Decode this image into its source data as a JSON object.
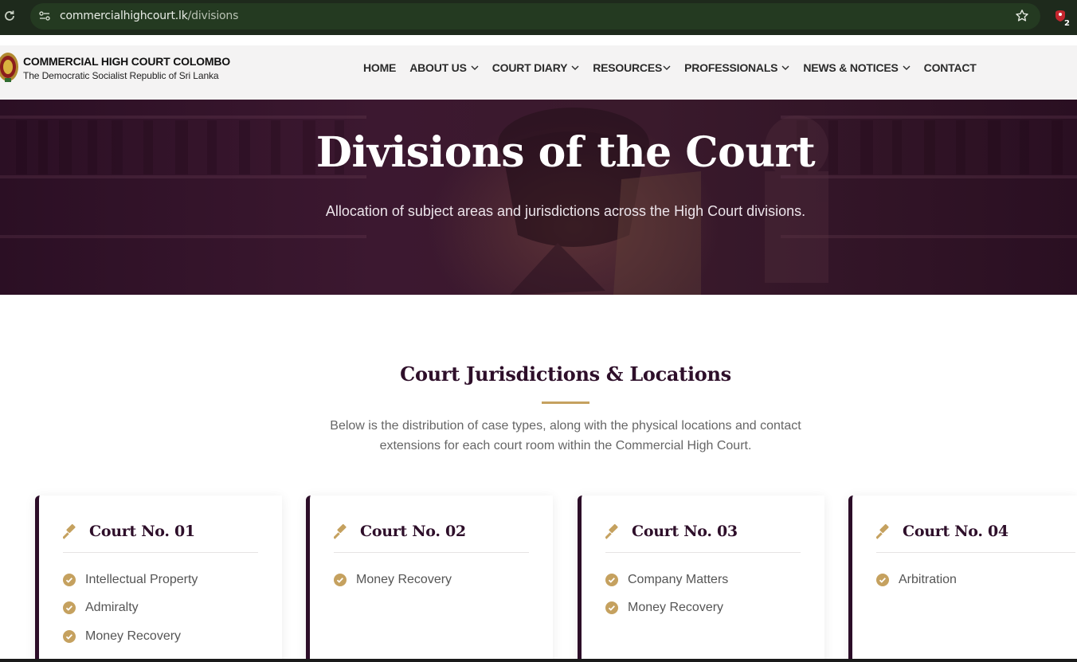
{
  "browser": {
    "url_domain": "commercialhighcourt.lk",
    "url_path": "/divisions",
    "extension_badge": "2"
  },
  "header": {
    "logo_title": "COMMERCIAL HIGH COURT COLOMBO",
    "logo_subtitle": "The Democratic Socialist Republic of Sri Lanka",
    "nav": [
      {
        "label": "HOME",
        "has_dropdown": false
      },
      {
        "label": "ABOUT US",
        "has_dropdown": true
      },
      {
        "label": "COURT DIARY",
        "has_dropdown": true
      },
      {
        "label": "RESOURCES",
        "has_dropdown": true
      },
      {
        "label": "PROFESSIONALS",
        "has_dropdown": true
      },
      {
        "label": "NEWS & NOTICES",
        "has_dropdown": true
      },
      {
        "label": "CONTACT",
        "has_dropdown": false
      }
    ]
  },
  "hero": {
    "title": "Divisions of the Court",
    "subtitle": "Allocation of subject areas and jurisdictions across the High Court divisions."
  },
  "section": {
    "title": "Court Jurisdictions & Locations",
    "description": "Below is the distribution of case types, along with the physical locations and contact extensions for each court room within the Commercial High Court."
  },
  "courts": [
    {
      "title": "Court No. 01",
      "items": [
        "Intellectual Property",
        "Admiralty",
        "Money Recovery"
      ]
    },
    {
      "title": "Court No. 02",
      "items": [
        "Money Recovery"
      ]
    },
    {
      "title": "Court No. 03",
      "items": [
        "Company Matters",
        "Money Recovery"
      ]
    },
    {
      "title": "Court No. 04",
      "items": [
        "Arbitration"
      ]
    }
  ],
  "colors": {
    "brand_purple": "#2e0f2a",
    "accent_gold": "#c5a15f",
    "browser_bar": "#1e2a1c"
  },
  "icons": {
    "reload": "reload-icon",
    "site_info": "site-info-icon",
    "bookmark": "star-icon",
    "extension": "extension-icon",
    "card_heading": "gavel-icon",
    "list_bullet": "check-circle-icon",
    "dropdown": "chevron-down-icon"
  }
}
